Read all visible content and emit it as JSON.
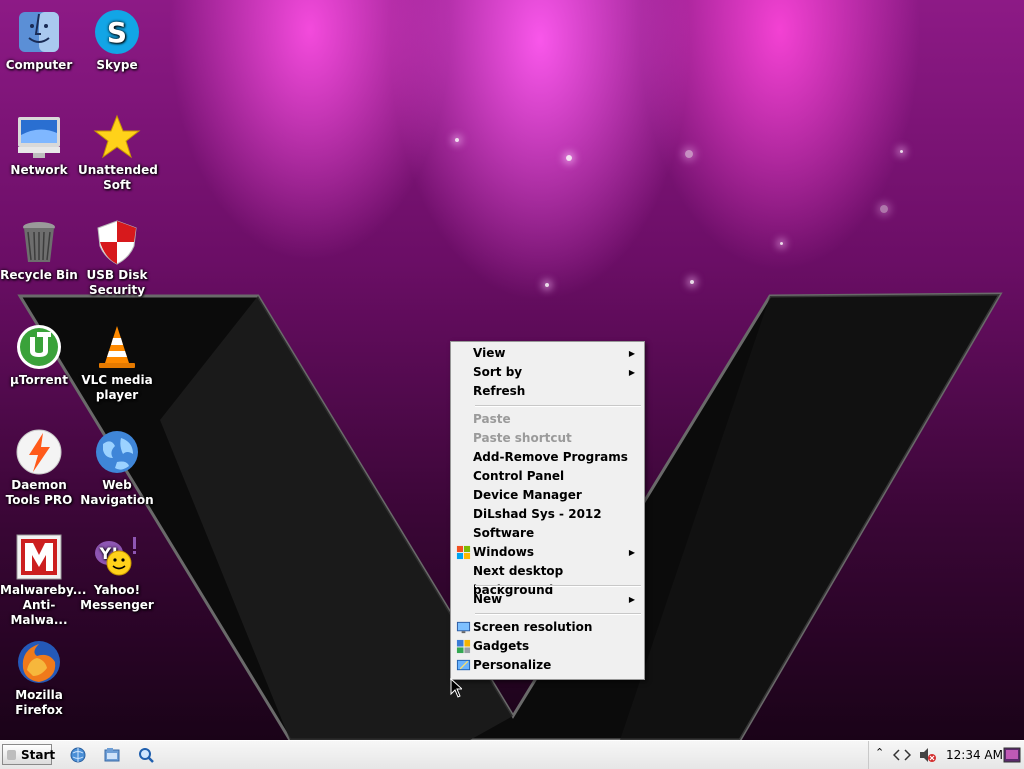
{
  "desktop_icons": [
    {
      "label": "Computer",
      "icon": "finder-computer-icon"
    },
    {
      "label": "Skype",
      "icon": "skype-icon"
    },
    {
      "label": "Network",
      "icon": "imac-network-icon"
    },
    {
      "label": "Unattended\nSoft",
      "icon": "star-icon"
    },
    {
      "label": "Recycle Bin",
      "icon": "trash-can-icon"
    },
    {
      "label": "USB Disk\nSecurity",
      "icon": "shield-icon"
    },
    {
      "label": "µTorrent",
      "icon": "utorrent-icon"
    },
    {
      "label": "VLC media\nplayer",
      "icon": "traffic-cone-icon"
    },
    {
      "label": "Daemon\nTools PRO",
      "icon": "lightning-bolt-icon"
    },
    {
      "label": "Web\nNavigation",
      "icon": "globe-icon"
    },
    {
      "label": "Malwareby...\nAnti-Malwa...",
      "icon": "malwarebytes-icon"
    },
    {
      "label": "Yahoo!\nMessenger",
      "icon": "yahoo-messenger-icon"
    },
    {
      "label": "Mozilla\nFirefox",
      "icon": "firefox-icon"
    }
  ],
  "context_menu": {
    "view": "View",
    "sort_by": "Sort by",
    "refresh": "Refresh",
    "paste": "Paste",
    "paste_shortcut": "Paste shortcut",
    "add_remove": "Add-Remove Programs",
    "control_panel": "Control Panel",
    "device_manager": "Device Manager",
    "dilshad": "DiLshad Sys - 2012",
    "software": "Software",
    "windows": "Windows",
    "next_bg": "Next desktop background",
    "new": "New",
    "screen_resolution": "Screen resolution",
    "gadgets": "Gadgets",
    "personalize": "Personalize"
  },
  "taskbar": {
    "start_label": "Start",
    "clock": "12:34 AM",
    "quick_launch": [
      "browser-globe-icon",
      "folder-icon",
      "search-magnifier-icon"
    ],
    "tray_icons": [
      "show-hidden-icons-chevron",
      "network-arrows-icon",
      "volume-muted-icon",
      "desktop-preview-icon"
    ]
  },
  "colors": {
    "wallpaper_magenta": "#e63cd2",
    "wallpaper_dark": "#1a0318",
    "menu_bg": "#f0f0f0",
    "taskbar_bg": "#eeeeee"
  }
}
